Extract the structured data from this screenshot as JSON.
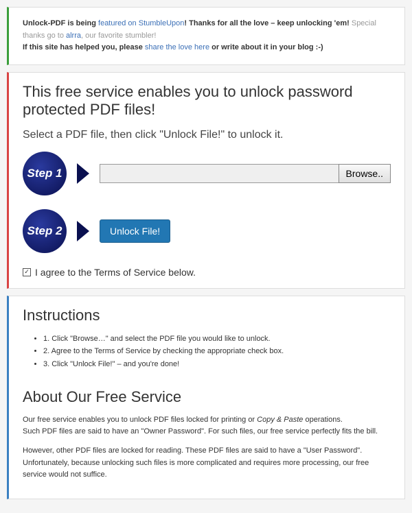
{
  "banner": {
    "part1": "Unlock-PDF is being ",
    "featured_link": "featured on StumbleUpon",
    "part2": "! Thanks for all the love – keep unlocking 'em!",
    "part3": " Special thanks go to ",
    "alrra_link": "alrra",
    "part4": ", our favorite stumbler!",
    "line2a": "If this site has helped you, please ",
    "share_link": "share the love here",
    "line2b": " or write about it in your blog :-)"
  },
  "main": {
    "title": "This free service enables you to unlock password protected PDF files!",
    "subtitle": "Select a PDF file, then click \"Unlock File!\" to unlock it.",
    "step1_label": "Step 1",
    "step2_label": "Step 2",
    "browse_label": "Browse..",
    "unlock_label": "Unlock File!",
    "agree_label": "I agree to the Terms of Service below.",
    "checkbox_mark": "✓"
  },
  "instructions": {
    "heading": "Instructions",
    "items": [
      "1. Click \"Browse…\" and select the PDF file you would like to unlock.",
      "2. Agree to the Terms of Service by checking the appropriate check box.",
      "3. Click \"Unlock File!\" – and you're done!"
    ]
  },
  "about": {
    "heading": "About Our Free Service",
    "p1a": "Our free service enables you to unlock PDF files locked for printing or ",
    "p1em": "Copy & Paste",
    "p1b": " operations.",
    "p2": "Such PDF files are said to have an \"Owner Password\". For such files, our free service perfectly fits the bill.",
    "p3": "However, other PDF files are locked for reading. These PDF files are said to have a \"User Password\".",
    "p4": "Unfortunately, because unlocking such files is more complicated and requires more processing, our free service would not suffice."
  }
}
